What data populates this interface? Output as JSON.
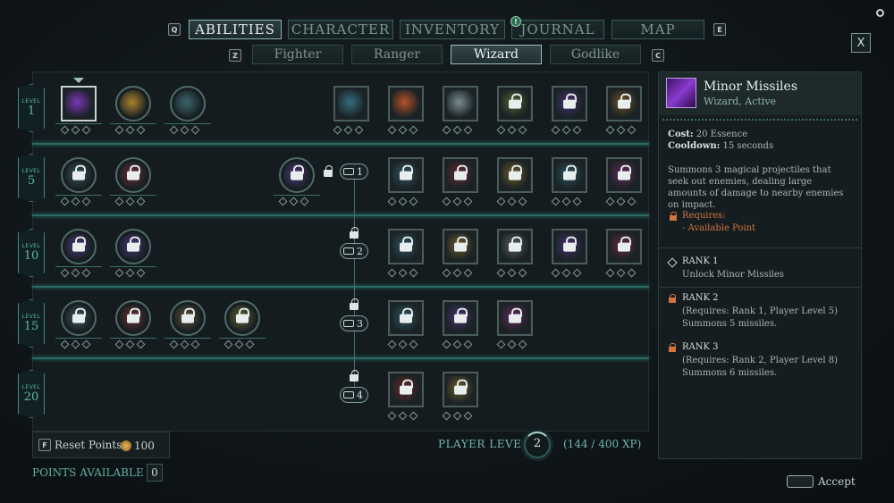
{
  "nav": {
    "left_key": "Q",
    "right_key": "E",
    "tabs": [
      {
        "label": "ABILITIES",
        "active": true
      },
      {
        "label": "CHARACTER",
        "active": false
      },
      {
        "label": "INVENTORY",
        "active": false
      },
      {
        "label": "JOURNAL",
        "active": false
      },
      {
        "label": "MAP",
        "active": false
      }
    ],
    "journal_badge": "!",
    "sub_left_key": "Z",
    "sub_right_key": "C",
    "subtabs": [
      {
        "label": "Fighter"
      },
      {
        "label": "Ranger"
      },
      {
        "label": "Wizard",
        "active": true
      },
      {
        "label": "Godlike"
      }
    ],
    "close_label": "X"
  },
  "levels": [
    {
      "label": "LEVEL",
      "num": "1"
    },
    {
      "label": "LEVEL",
      "num": "5"
    },
    {
      "label": "LEVEL",
      "num": "10"
    },
    {
      "label": "LEVEL",
      "num": "15"
    },
    {
      "label": "LEVEL",
      "num": "20"
    }
  ],
  "feats": [
    "1",
    "2",
    "3",
    "4"
  ],
  "detail": {
    "title": "Minor Missiles",
    "subtitle": "Wizard, Active",
    "cost_label": "Cost:",
    "cost_value": "20 Essence",
    "cooldown_label": "Cooldown:",
    "cooldown_value": "15 seconds",
    "description": "Summons 3 magical projectiles that seek out enemies, dealing large amounts of damage to nearby enemies on impact.",
    "requires_label": "Requires:",
    "requires_item": "- Available Point",
    "ranks": [
      {
        "title": "RANK 1",
        "req": "",
        "desc": "Unlock Minor Missiles"
      },
      {
        "title": "RANK 2",
        "req": "(Requires: Rank 1, Player Level 5)",
        "desc": "Summons 5 missiles."
      },
      {
        "title": "RANK 3",
        "req": "(Requires: Rank 2, Player Level 8)",
        "desc": "Summons 6 missiles."
      }
    ]
  },
  "footer": {
    "reset_key": "F",
    "reset_label": "Reset Points",
    "reset_cost": "100",
    "player_level_label": "PLAYER LEVEL",
    "player_level": "2",
    "xp": "(144 / 400 XP)",
    "points_label": "POINTS AVAILABLE",
    "points_value": "0",
    "accept_label": "Accept"
  },
  "colors": {
    "accent": "#2b8a7e",
    "warning": "#d0753e",
    "selected_ability": "#8a3ad0"
  }
}
